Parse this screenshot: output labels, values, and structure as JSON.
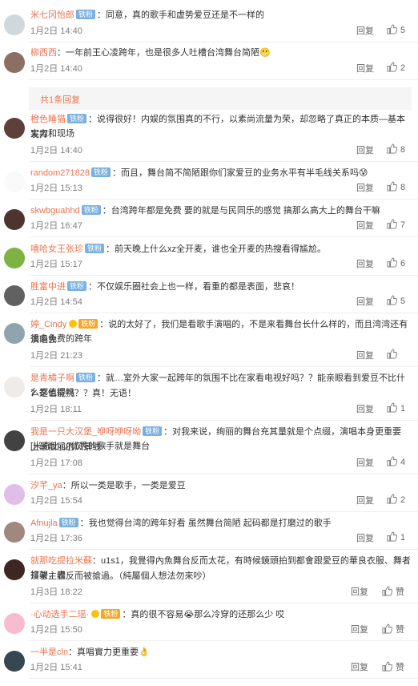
{
  "comments": [
    {
      "user": "米七冈怡郎",
      "badges": [
        "铁粉"
      ],
      "text": "：同意，真的歌手和虚势爱豆还是不一样的",
      "time": "1月2日 14:40",
      "reply": "回复",
      "likes": "5",
      "avatar_color": "#cfd8dc"
    },
    {
      "user": "柳西西",
      "badges": [],
      "text": "：一年前王心凌跨年，也是很多人吐槽台湾舞台简陋😬",
      "time": "1月2日 14:40",
      "reply": "回复",
      "likes": "2",
      "avatar_color": "#8d6e63"
    },
    {
      "user": "橙色睡猫",
      "badges": [
        "铁粉"
      ],
      "text": "：说得很好！内娱的氛围真的不行，以素尚流量为荣，却忽略了真正的本质—基本实力和现场发挥！",
      "time": "1月2日 14:40",
      "reply": "回复",
      "likes": "8",
      "avatar_color": "#5d4037"
    },
    {
      "user": "random271828",
      "badges": [
        "铁粉"
      ],
      "text": "：而且，舞台简不简陋跟你们家爱豆的业务水平有半毛线关系吗😰",
      "time": "1月2日 15:13",
      "reply": "回复",
      "likes": "8",
      "avatar_color": "#fafafa"
    },
    {
      "user": "skwbguahhd",
      "badges": [
        "铁粉"
      ],
      "text": "：台湾跨年都是免费 要的就是与民同乐的感觉 搞那么高大上的舞台干嘛",
      "time": "1月2日 16:47",
      "reply": "回复",
      "likes": "7",
      "avatar_color": "#4e342e"
    },
    {
      "user": "嘻哈女王张珍",
      "badges": [
        "铁粉"
      ],
      "text": "：前天晚上什么xz全开麦，谁也全开麦的热搜看得尴尬。",
      "time": "1月2日 15:17",
      "reply": "回复",
      "likes": "6",
      "avatar_color": "#7cb342"
    },
    {
      "user": "胜富中进",
      "badges": [
        "铁粉"
      ],
      "text": "：不仅娱乐圈社会上也一样，看重的都是表面，悲哀！",
      "time": "1月2日 14:54",
      "reply": "回复",
      "likes": "5",
      "avatar_color": "#616161"
    },
    {
      "user": "婷_Cindy",
      "badges": [
        "V",
        "铁粉"
      ],
      "text": "：说的太好了，我们是看歌手演唱的，不是来看舞台长什么样的，而且湾湾还有很多免费的跨年演唱会",
      "time": "1月2日 21:23",
      "reply": "回复",
      "likes": "",
      "avatar_color": "#90a4ae"
    },
    {
      "user": "是青橘子啊",
      "badges": [
        "铁粉"
      ],
      "text": "：就…室外大家一起跨年的氛围不比在家看电视好吗？？能亲眼看到爱豆不比什么都值得吗？这也能挑？？真！无语！",
      "time": "1月2日 18:11",
      "reply": "回复",
      "likes": "1",
      "avatar_color": "#efebe9"
    },
    {
      "user": "我是一只大汉堡_咿呀咿呀呦",
      "badges": [
        "铁粉"
      ],
      "text": "：对我来说，绚丽的舞台充其量就是个点缀，演唱本身更重要[米奇比心]优秀的歌手就是舞台上最靓丽的风景线~",
      "time": "1月2日 17:08",
      "reply": "回复",
      "likes": "4",
      "avatar_color": "#424242"
    },
    {
      "user": "汐芊_ya",
      "badges": [],
      "text": "：所以一类是歌手，一类是爱豆",
      "time": "1月2日 15:54",
      "reply": "回复",
      "likes": "2",
      "avatar_color": "#e1bee7"
    },
    {
      "user": "Afnujla",
      "badges": [
        "铁粉"
      ],
      "text": "：我也觉得台湾的跨年好看 虽然舞台简陋 起码都是打磨过的歌手",
      "time": "1月2日 17:36",
      "reply": "回复",
      "likes": "1",
      "avatar_color": "#a1887f"
    },
    {
      "user": "就那吃提拉米蘇",
      "badges": [],
      "text": "：u1s1，我覺得內魚舞台反而太花，有時候鏡頭拍到都會跟愛豆的華良衣服、舞者打架，表演者主體反而被搶過。（純屬個人想法勿來吵）",
      "time": "1月3日 18:22",
      "reply": "回复",
      "likes": "赞",
      "avatar_color": "#3e2723"
    },
    {
      "user": "·心动选手二瑶·",
      "badges": [
        "V",
        "铁粉"
      ],
      "text": "：真的很不容易😭那么冷穿的还那么少 哎",
      "time": "1月2日 15:50",
      "reply": "回复",
      "likes": "赞",
      "avatar_color": "#f8bbd0"
    },
    {
      "user": "一半是cln",
      "badges": [],
      "text": "：真唱實力更重要👌",
      "time": "1月2日 15:41",
      "reply": "回复",
      "likes": "赞",
      "avatar_color": "#37474f"
    }
  ],
  "more_replies": "共1条回复",
  "colors": {
    "username": "#eb7350",
    "time": "#808080",
    "badge": "#7ab0e0"
  }
}
